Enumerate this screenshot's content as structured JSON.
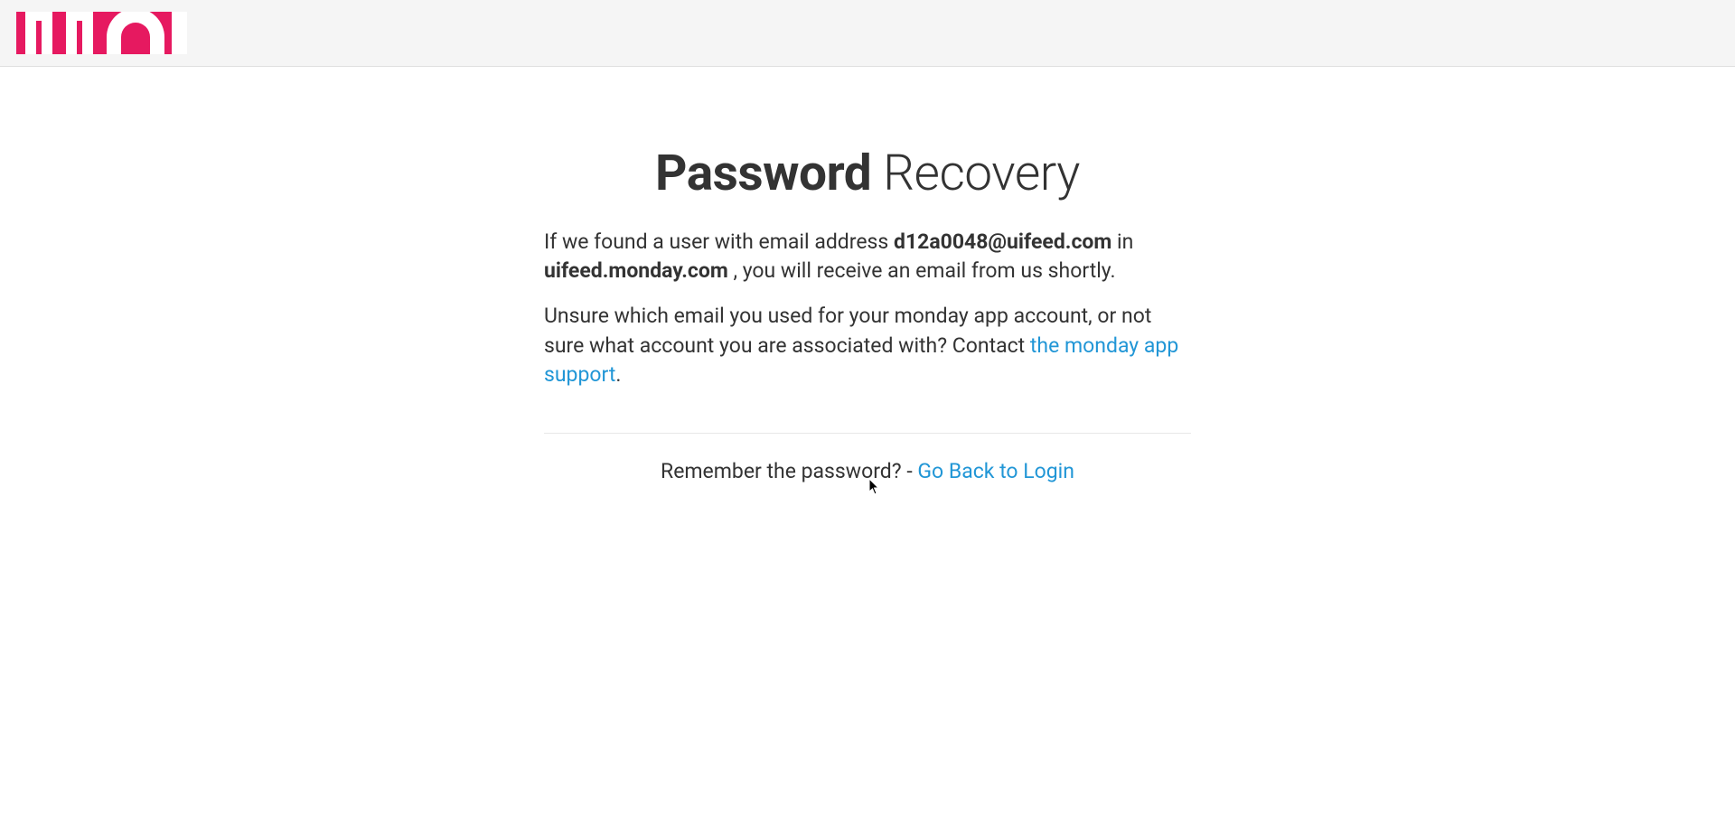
{
  "title": {
    "bold": "Password",
    "light": " Recovery"
  },
  "message1": {
    "part1": "If we found a user with email address ",
    "email": "d12a0048@uifeed.com",
    "part2": " in ",
    "domain": "uifeed.monday.com",
    "part3": " , you will receive an email from us shortly."
  },
  "message2": {
    "part1": "Unsure which email you used for your monday app account, or not sure what account you are associated with? Contact ",
    "link": "the monday app support",
    "part2": "."
  },
  "footer": {
    "text": "Remember the password? - ",
    "link": "Go Back to Login"
  }
}
